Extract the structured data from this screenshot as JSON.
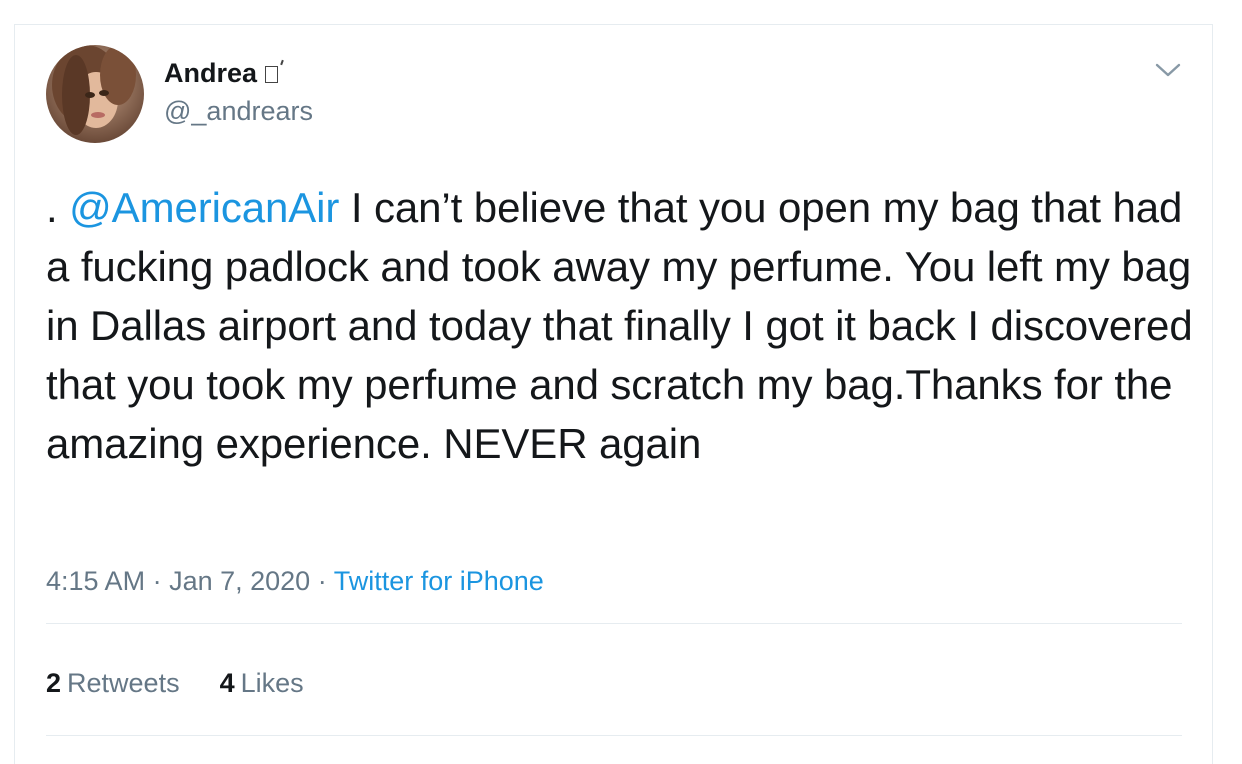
{
  "user": {
    "name": "Andrea",
    "handle": "@_andrears"
  },
  "tweet": {
    "prefix": ". ",
    "mention": "@AmericanAir",
    "text": " I can’t believe that you open my bag that had a fucking padlock and took away my perfume. You left my bag in Dallas airport and today that finally I got it back I discovered that you took my perfume and scratch my bag.Thanks for the amazing experience. NEVER again"
  },
  "meta": {
    "time": "4:15 AM",
    "separator": " · ",
    "date": "Jan 7, 2020",
    "source": "Twitter for iPhone"
  },
  "stats": {
    "retweets_count": "2",
    "retweets_label": "Retweets",
    "likes_count": "4",
    "likes_label": "Likes"
  },
  "icons": {
    "more": "chevron-down-icon",
    "badge": "unrendered-emoji-box"
  },
  "colors": {
    "link": "#1b95e0",
    "secondary": "#657786",
    "primary": "#14171a",
    "divider": "#e6ecf0"
  }
}
